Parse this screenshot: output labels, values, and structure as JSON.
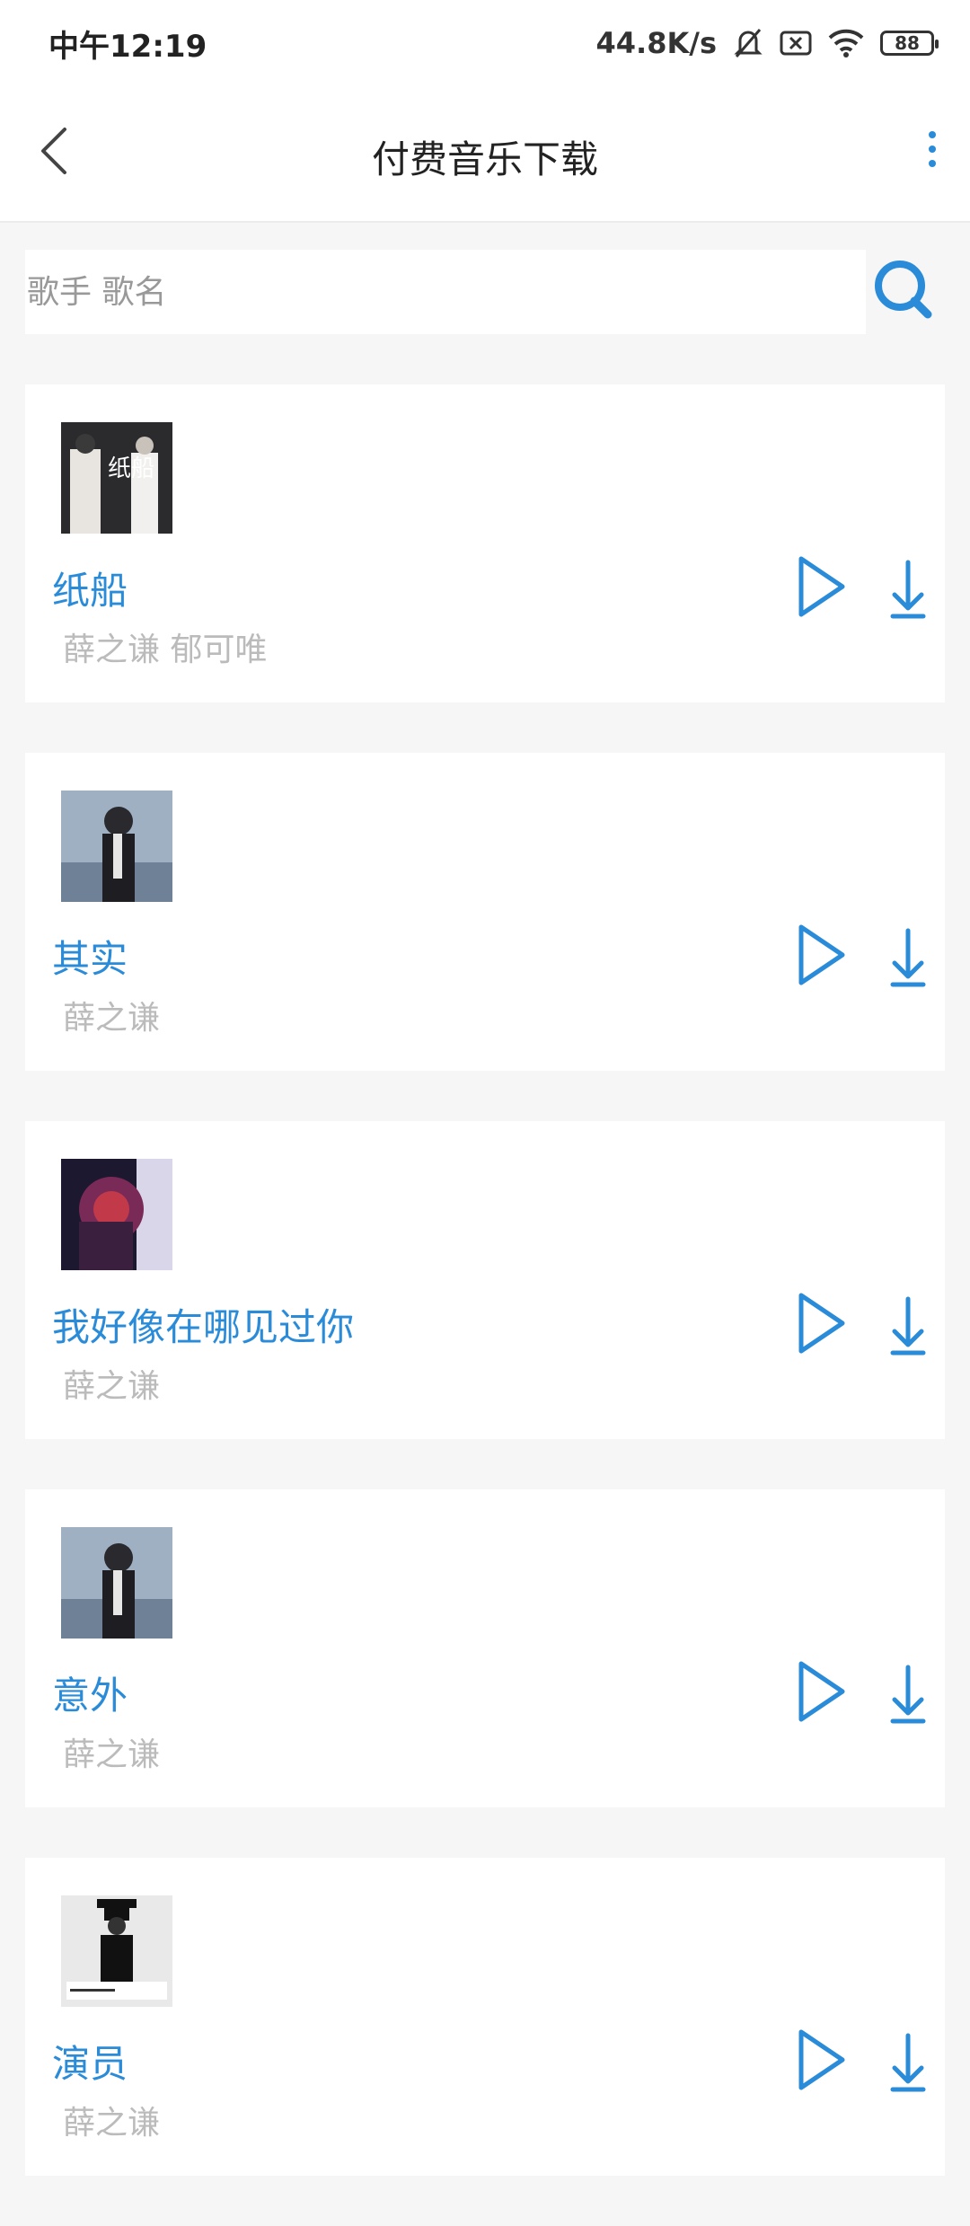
{
  "status_bar": {
    "time": "中午12:19",
    "net_speed": "44.8K/s",
    "battery": "88"
  },
  "header": {
    "title": "付费音乐下载"
  },
  "search": {
    "placeholder": "歌手 歌名",
    "value": ""
  },
  "songs": [
    {
      "title": "纸船",
      "artist": "薛之谦 郁可唯",
      "cover_text": "纸船"
    },
    {
      "title": "其实",
      "artist": "薛之谦"
    },
    {
      "title": "我好像在哪见过你",
      "artist": "薛之谦"
    },
    {
      "title": "意外",
      "artist": "薛之谦"
    },
    {
      "title": "演员",
      "artist": "薛之谦"
    }
  ],
  "colors": {
    "accent": "#2a8bd8",
    "artist_text": "#bbbbbb",
    "background": "#f6f6f6"
  },
  "icons": {
    "back": "chevron-left-icon",
    "more": "more-vertical-icon",
    "search": "search-icon",
    "play": "play-icon",
    "download": "download-icon"
  }
}
